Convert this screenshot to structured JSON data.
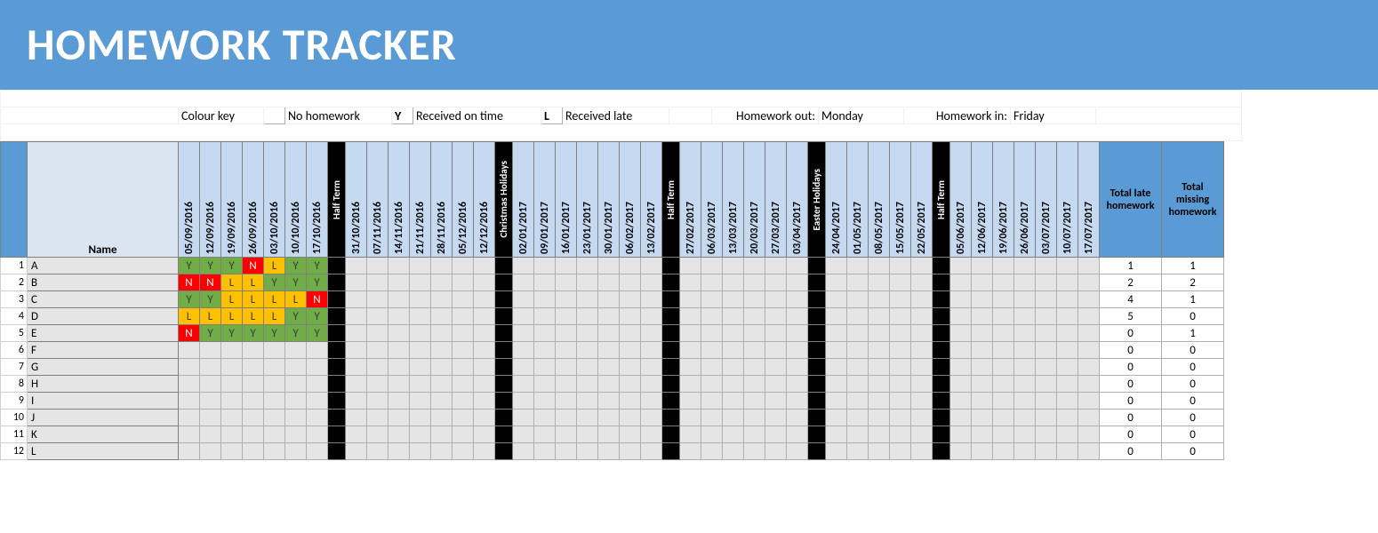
{
  "title": "HOMEWORK TRACKER",
  "legend": {
    "label": "Colour key",
    "items": {
      "N": "No homework",
      "Y": "Received on time",
      "L": "Received late"
    },
    "hw_out_label": "Homework out:",
    "hw_out_value": "Monday",
    "hw_in_label": "Homework in:",
    "hw_in_value": "Friday"
  },
  "name_header": "Name",
  "totals_headers": {
    "late": "Total late homework",
    "missing": "Total missing homework"
  },
  "columns": [
    {
      "type": "date",
      "label": "05/09/2016"
    },
    {
      "type": "date",
      "label": "12/09/2016"
    },
    {
      "type": "date",
      "label": "19/09/2016"
    },
    {
      "type": "date",
      "label": "26/09/2016"
    },
    {
      "type": "date",
      "label": "03/10/2016"
    },
    {
      "type": "date",
      "label": "10/10/2016"
    },
    {
      "type": "date",
      "label": "17/10/2016"
    },
    {
      "type": "break",
      "label": "Half Term"
    },
    {
      "type": "date",
      "label": "31/10/2016"
    },
    {
      "type": "date",
      "label": "07/11/2016"
    },
    {
      "type": "date",
      "label": "14/11/2016"
    },
    {
      "type": "date",
      "label": "21/11/2016"
    },
    {
      "type": "date",
      "label": "28/11/2016"
    },
    {
      "type": "date",
      "label": "05/12/2016"
    },
    {
      "type": "date",
      "label": "12/12/2016"
    },
    {
      "type": "break",
      "label": "Christmas Holidays"
    },
    {
      "type": "date",
      "label": "02/01/2017"
    },
    {
      "type": "date",
      "label": "09/01/2017"
    },
    {
      "type": "date",
      "label": "16/01/2017"
    },
    {
      "type": "date",
      "label": "23/01/2017"
    },
    {
      "type": "date",
      "label": "30/01/2017"
    },
    {
      "type": "date",
      "label": "06/02/2017"
    },
    {
      "type": "date",
      "label": "13/02/2017"
    },
    {
      "type": "break",
      "label": "Half Term"
    },
    {
      "type": "date",
      "label": "27/02/2017"
    },
    {
      "type": "date",
      "label": "06/03/2017"
    },
    {
      "type": "date",
      "label": "13/03/2017"
    },
    {
      "type": "date",
      "label": "20/03/2017"
    },
    {
      "type": "date",
      "label": "27/03/2017"
    },
    {
      "type": "date",
      "label": "03/04/2017"
    },
    {
      "type": "break",
      "label": "Easter Holidays"
    },
    {
      "type": "date",
      "label": "24/04/2017"
    },
    {
      "type": "date",
      "label": "01/05/2017"
    },
    {
      "type": "date",
      "label": "08/05/2017"
    },
    {
      "type": "date",
      "label": "15/05/2017"
    },
    {
      "type": "date",
      "label": "22/05/2017"
    },
    {
      "type": "break",
      "label": "Half Term"
    },
    {
      "type": "date",
      "label": "05/06/2017"
    },
    {
      "type": "date",
      "label": "12/06/2017"
    },
    {
      "type": "date",
      "label": "19/06/2017"
    },
    {
      "type": "date",
      "label": "26/06/2017"
    },
    {
      "type": "date",
      "label": "03/07/2017"
    },
    {
      "type": "date",
      "label": "10/07/2017"
    },
    {
      "type": "date",
      "label": "17/07/2017"
    }
  ],
  "rows": [
    {
      "name": "A",
      "weeks": [
        "Y",
        "Y",
        "Y",
        "N",
        "L",
        "Y",
        "Y"
      ],
      "late": 1,
      "missing": 1
    },
    {
      "name": "B",
      "weeks": [
        "N",
        "N",
        "L",
        "L",
        "Y",
        "Y",
        "Y"
      ],
      "late": 2,
      "missing": 2
    },
    {
      "name": "C",
      "weeks": [
        "Y",
        "Y",
        "L",
        "L",
        "L",
        "L",
        "N"
      ],
      "late": 4,
      "missing": 1
    },
    {
      "name": "D",
      "weeks": [
        "L",
        "L",
        "L",
        "L",
        "L",
        "Y",
        "Y"
      ],
      "late": 5,
      "missing": 0
    },
    {
      "name": "E",
      "weeks": [
        "N",
        "Y",
        "Y",
        "Y",
        "Y",
        "Y",
        "Y"
      ],
      "late": 0,
      "missing": 1
    },
    {
      "name": "F",
      "weeks": [],
      "late": 0,
      "missing": 0
    },
    {
      "name": "G",
      "weeks": [],
      "late": 0,
      "missing": 0
    },
    {
      "name": "H",
      "weeks": [],
      "late": 0,
      "missing": 0
    },
    {
      "name": "I",
      "weeks": [],
      "late": 0,
      "missing": 0
    },
    {
      "name": "J",
      "weeks": [],
      "late": 0,
      "missing": 0
    },
    {
      "name": "K",
      "weeks": [],
      "late": 0,
      "missing": 0
    },
    {
      "name": "L",
      "weeks": [],
      "late": 0,
      "missing": 0
    }
  ]
}
